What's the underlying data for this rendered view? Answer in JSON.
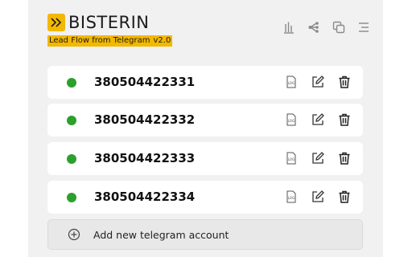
{
  "brand": {
    "name": "BISTERIN",
    "tagline": "Lead Flow from Telegram",
    "version": "v2.0",
    "accent_color": "#f3b800"
  },
  "header_icons": [
    "stats-icon",
    "flow-icon",
    "copy-icon",
    "menu-icon"
  ],
  "accounts": [
    {
      "phone": "380504422331",
      "status": "online",
      "status_color": "#2ca02c"
    },
    {
      "phone": "380504422332",
      "status": "online",
      "status_color": "#2ca02c"
    },
    {
      "phone": "380504422333",
      "status": "online",
      "status_color": "#2ca02c"
    },
    {
      "phone": "380504422334",
      "status": "online",
      "status_color": "#2ca02c"
    }
  ],
  "row_action_icons": [
    "logs-icon",
    "edit-icon",
    "delete-icon"
  ],
  "add_account": {
    "label": "Add new telegram account",
    "icon": "plus-circle-icon"
  }
}
